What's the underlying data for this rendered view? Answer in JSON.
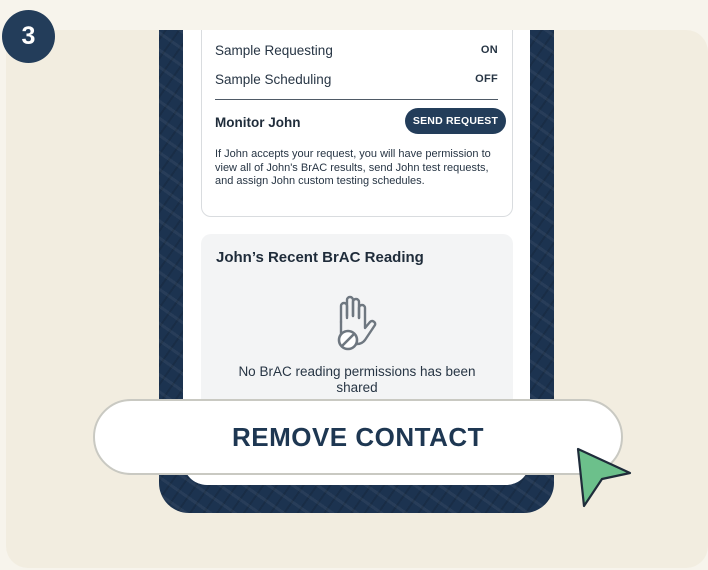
{
  "step": {
    "number": "3"
  },
  "settings": {
    "rows": [
      {
        "label": "Sample Requesting",
        "value": "ON"
      },
      {
        "label": "Sample Scheduling",
        "value": "OFF"
      }
    ]
  },
  "monitor": {
    "name": "Monitor John",
    "button_label": "SEND REQUEST",
    "info": "If John accepts your request, you will have permission to view all of John's BrAC results, send John test requests, and assign John custom testing schedules."
  },
  "brac": {
    "title": "John’s Recent BrAC Reading",
    "icon": "hand-blocked-icon",
    "empty_message": "No BrAC reading permissions has been shared"
  },
  "action": {
    "remove_label": "REMOVE CONTACT"
  },
  "colors": {
    "navy": "#233d5a",
    "cursor_green": "#6cc08b",
    "background": "#f2ede0"
  }
}
